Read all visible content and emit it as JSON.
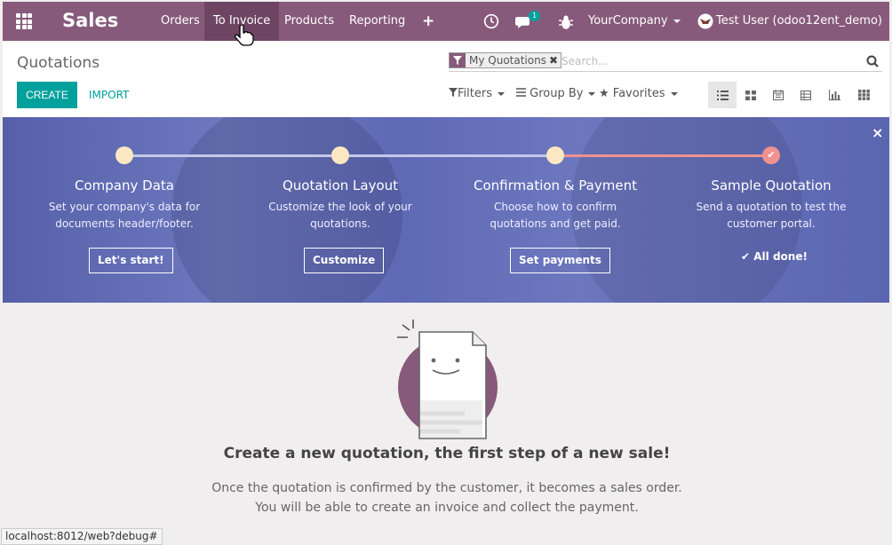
{
  "navbar": {
    "brand": "Sales",
    "menu": [
      "Orders",
      "To Invoice",
      "Products",
      "Reporting"
    ],
    "active_menu": "To Invoice",
    "message_count": "1",
    "company": "YourCompany",
    "user": "Test User (odoo12ent_demo)",
    "bg_color": "#875a7b"
  },
  "control_panel": {
    "breadcrumb": "Quotations",
    "facet_label": "My Quotations",
    "search_placeholder": "Search...",
    "create_label": "CREATE",
    "import_label": "IMPORT",
    "filters_label": "Filters",
    "groupby_label": "Group By",
    "favorites_label": "Favorites",
    "views": [
      "list",
      "kanban",
      "calendar",
      "pivot",
      "graph",
      "dashboard"
    ],
    "active_view": "list",
    "accent_color": "#00a09d"
  },
  "onboarding": {
    "steps": [
      {
        "title": "Company Data",
        "desc": "Set your company's data for documents header/footer.",
        "button": "Let's start!"
      },
      {
        "title": "Quotation Layout",
        "desc": "Customize the look of your quotations.",
        "button": "Customize"
      },
      {
        "title": "Confirmation & Payment",
        "desc": "Choose how to confirm quotations and get paid.",
        "button": "Set payments"
      },
      {
        "title": "Sample Quotation",
        "desc": "Send a quotation to test the customer portal.",
        "done_label": "All done!"
      }
    ]
  },
  "empty_state": {
    "title": "Create a new quotation, the first step of a new sale!",
    "line1": "Once the quotation is confirmed by the customer, it becomes a sales order.",
    "line2": "You will be able to create an invoice and collect the payment."
  },
  "status_bar": {
    "url": "localhost:8012/web?debug#"
  }
}
